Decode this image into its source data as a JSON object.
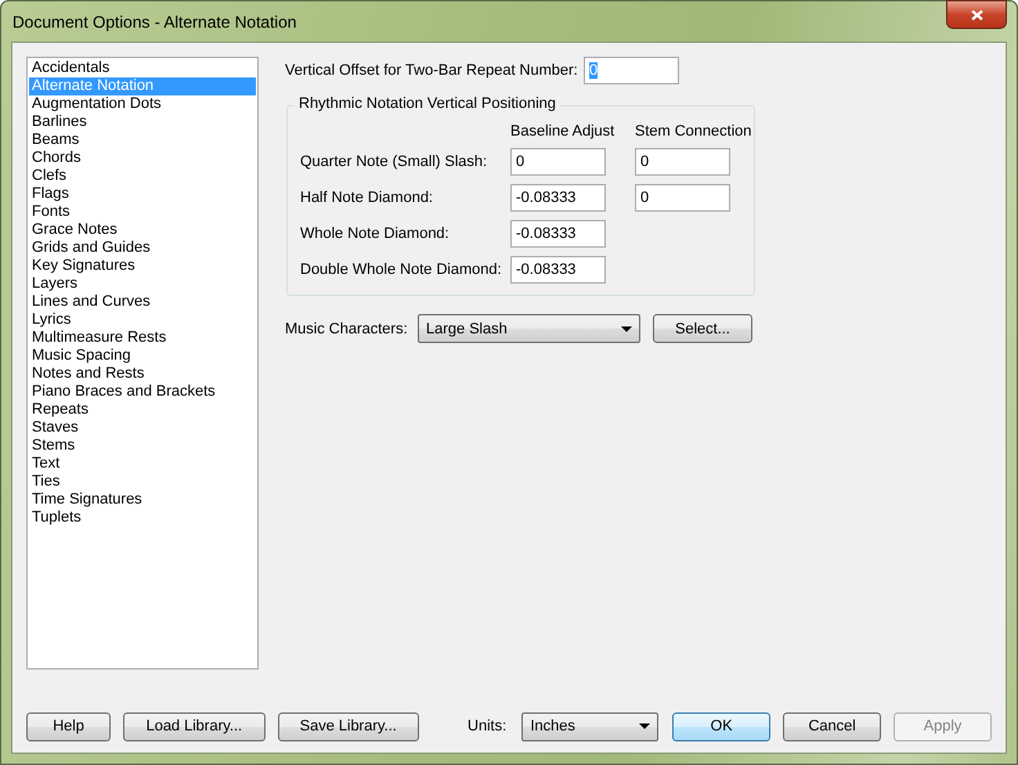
{
  "window": {
    "title": "Document Options - Alternate Notation"
  },
  "categories": [
    {
      "label": "Accidentals",
      "selected": false
    },
    {
      "label": "Alternate Notation",
      "selected": true
    },
    {
      "label": "Augmentation Dots",
      "selected": false
    },
    {
      "label": "Barlines",
      "selected": false
    },
    {
      "label": "Beams",
      "selected": false
    },
    {
      "label": "Chords",
      "selected": false
    },
    {
      "label": "Clefs",
      "selected": false
    },
    {
      "label": "Flags",
      "selected": false
    },
    {
      "label": "Fonts",
      "selected": false
    },
    {
      "label": "Grace Notes",
      "selected": false
    },
    {
      "label": "Grids and Guides",
      "selected": false
    },
    {
      "label": "Key Signatures",
      "selected": false
    },
    {
      "label": "Layers",
      "selected": false
    },
    {
      "label": "Lines and Curves",
      "selected": false
    },
    {
      "label": "Lyrics",
      "selected": false
    },
    {
      "label": "Multimeasure Rests",
      "selected": false
    },
    {
      "label": "Music Spacing",
      "selected": false
    },
    {
      "label": "Notes and Rests",
      "selected": false
    },
    {
      "label": "Piano Braces and Brackets",
      "selected": false
    },
    {
      "label": "Repeats",
      "selected": false
    },
    {
      "label": "Staves",
      "selected": false
    },
    {
      "label": "Stems",
      "selected": false
    },
    {
      "label": "Text",
      "selected": false
    },
    {
      "label": "Ties",
      "selected": false
    },
    {
      "label": "Time Signatures",
      "selected": false
    },
    {
      "label": "Tuplets",
      "selected": false
    }
  ],
  "repeat_offset": {
    "label": "Vertical Offset for Two-Bar Repeat Number:",
    "value": "0",
    "highlighted": true
  },
  "rhythmic_group": {
    "title": "Rhythmic Notation Vertical Positioning",
    "columns": [
      "Baseline Adjust",
      "Stem Connection"
    ],
    "rows": [
      {
        "label": "Quarter Note (Small) Slash:",
        "baseline": "0",
        "stem": "0"
      },
      {
        "label": "Half Note Diamond:",
        "baseline": "-0.08333",
        "stem": "0"
      },
      {
        "label": "Whole Note Diamond:",
        "baseline": "-0.08333"
      },
      {
        "label": "Double Whole Note Diamond:",
        "baseline": "-0.08333"
      }
    ]
  },
  "music_characters": {
    "label": "Music Characters:",
    "value": "Large Slash",
    "button": "Select..."
  },
  "footer": {
    "buttons_left": [
      {
        "label": "Help"
      },
      {
        "label": "Load Library..."
      },
      {
        "label": "Save Library..."
      }
    ],
    "units_label": "Units:",
    "units_value": "Inches",
    "buttons_right": [
      {
        "label": "OK",
        "default": true,
        "disabled": false
      },
      {
        "label": "Cancel",
        "default": false,
        "disabled": false
      },
      {
        "label": "Apply",
        "default": false,
        "disabled": true
      }
    ]
  }
}
